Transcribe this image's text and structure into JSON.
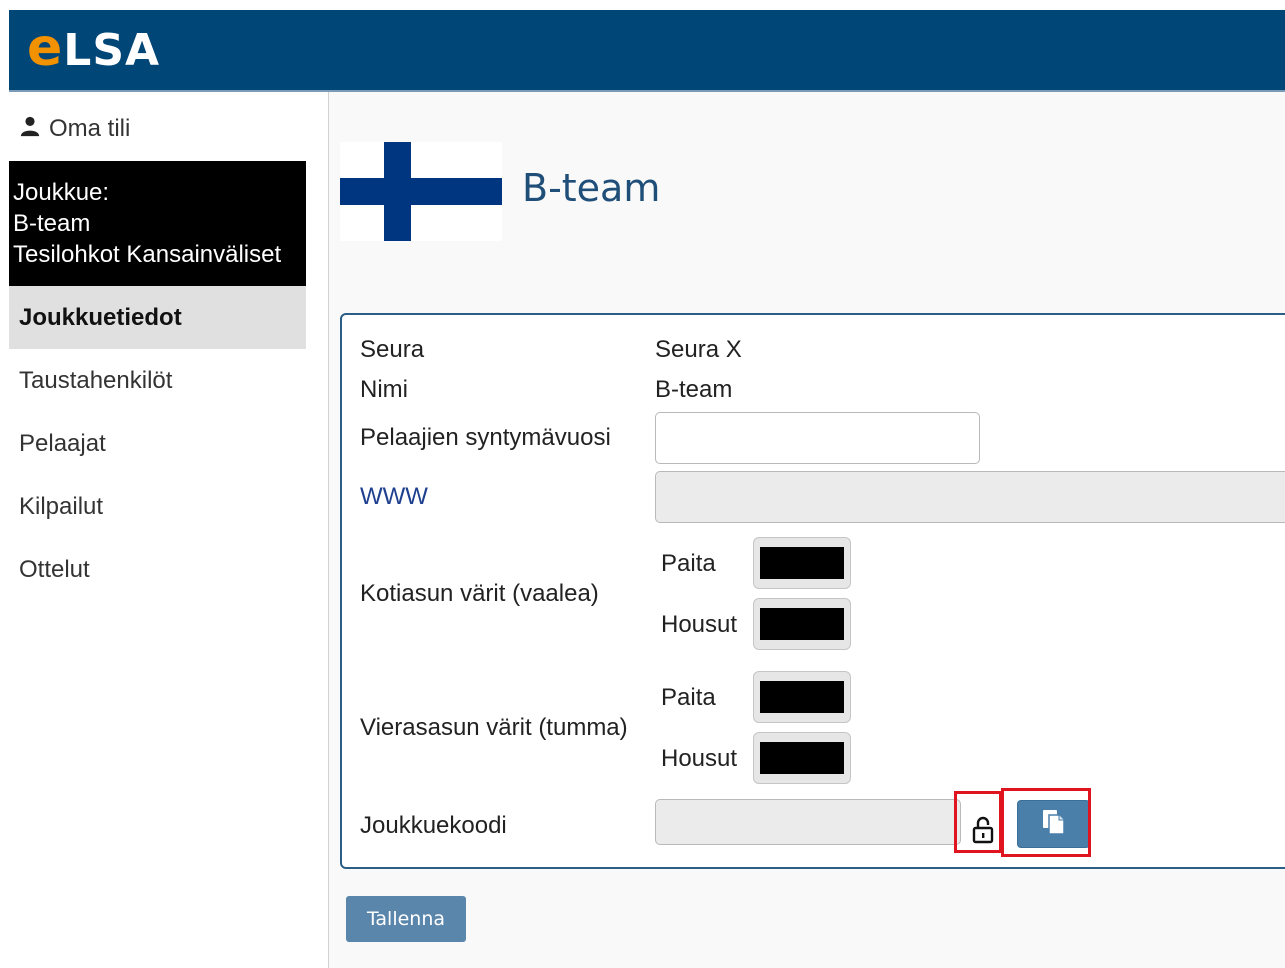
{
  "header": {
    "logo_e": "e",
    "logo_rest": "LSA"
  },
  "sidebar": {
    "account_label": "Oma tili",
    "team_info": {
      "line1": "Joukkue:",
      "line2": "B-team",
      "line3": "Tesilohkot Kansainväliset"
    },
    "nav": [
      {
        "label": "Joukkuetiedot",
        "active": true
      },
      {
        "label": "Taustahenkilöt"
      },
      {
        "label": "Pelaajat"
      },
      {
        "label": "Kilpailut"
      },
      {
        "label": "Ottelut"
      }
    ]
  },
  "main": {
    "team_title": "B-team",
    "form": {
      "club_label": "Seura",
      "club_value": "Seura X",
      "name_label": "Nimi",
      "name_value": "B-team",
      "birth_year_label": "Pelaajien syntymävuosi",
      "birth_year_value": "",
      "www_label": "WWW",
      "www_value": "",
      "home_colors_label": "Kotiasun värit (vaalea)",
      "away_colors_label": "Vierasasun värit (tumma)",
      "shirt_label": "Paita",
      "shorts_label": "Housut",
      "team_code_label": "Joukkuekoodi",
      "team_code_value": ""
    },
    "save_label": "Tallenna"
  },
  "colors": {
    "header_bg": "#004677",
    "logo_accent": "#f39200",
    "title_color": "#1f4e79",
    "button_bg": "#5b86ab",
    "highlight": "#e0141e",
    "swatch_home_shirt": "#000000",
    "swatch_home_shorts": "#000000",
    "swatch_away_shirt": "#000000",
    "swatch_away_shorts": "#000000"
  },
  "icons": [
    "user-icon",
    "finland-flag-icon",
    "lock-icon",
    "copy-icon"
  ]
}
